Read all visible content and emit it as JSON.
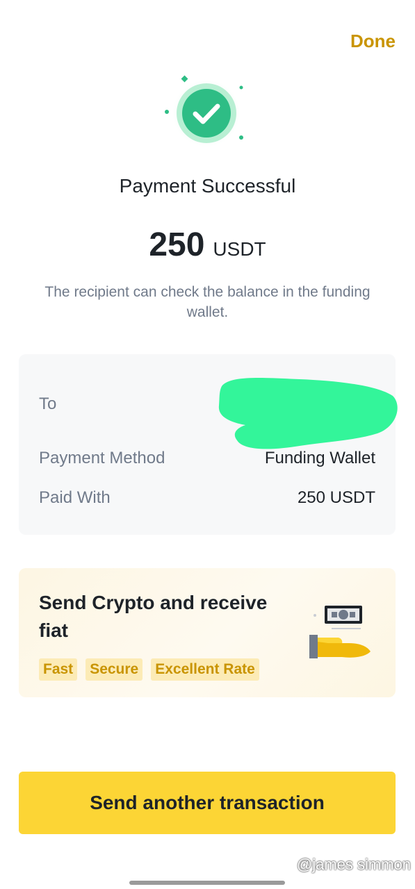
{
  "header": {
    "done_label": "Done"
  },
  "status": {
    "title": "Payment Successful",
    "amount": "250",
    "currency": "USDT",
    "note": "The recipient can check the balance in the funding wallet."
  },
  "details": {
    "rows": [
      {
        "label": "To",
        "value": ""
      },
      {
        "label": "Payment Method",
        "value": "Funding Wallet"
      },
      {
        "label": "Paid With",
        "value": "250 USDT"
      }
    ]
  },
  "promo": {
    "title": "Send Crypto and receive fiat",
    "tags": [
      "Fast",
      "Secure",
      "Excellent Rate"
    ]
  },
  "cta": {
    "label": "Send another transaction"
  },
  "watermark": "@james simmon",
  "colors": {
    "brand_yellow": "#fcd535",
    "accent_gold": "#c99400",
    "success_green": "#2ebd85",
    "redaction_green": "#33f59a"
  }
}
